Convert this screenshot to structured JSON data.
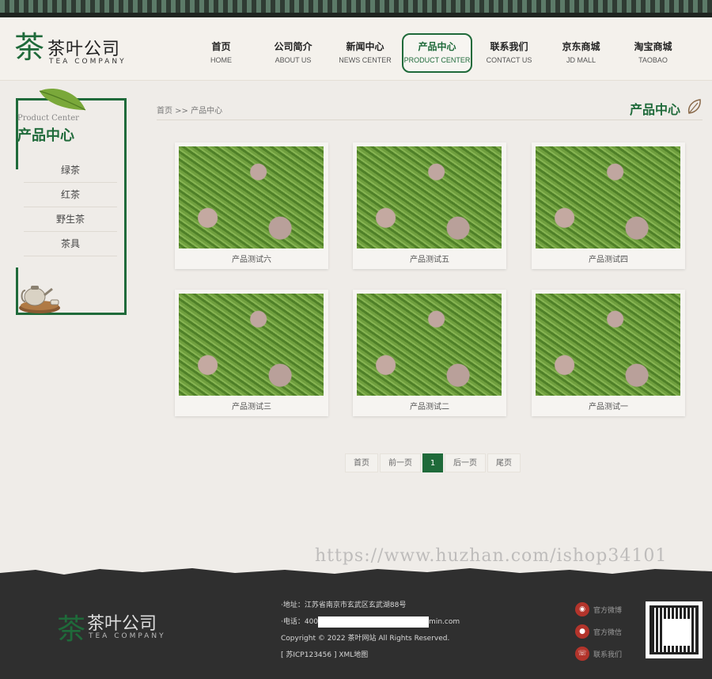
{
  "logo": {
    "mark": "茶",
    "name": "茶叶公司",
    "sub": "TEA COMPANY"
  },
  "nav": [
    {
      "cn": "首页",
      "en": "HOME"
    },
    {
      "cn": "公司简介",
      "en": "ABOUT US"
    },
    {
      "cn": "新闻中心",
      "en": "NEWS CENTER"
    },
    {
      "cn": "产品中心",
      "en": "PRODUCT CENTER"
    },
    {
      "cn": "联系我们",
      "en": "CONTACT US"
    },
    {
      "cn": "京东商城",
      "en": "JD MALL"
    },
    {
      "cn": "淘宝商城",
      "en": "TAOBAO"
    }
  ],
  "sidebar": {
    "en_title": "Product Center",
    "title": "产品中心",
    "items": [
      "绿茶",
      "红茶",
      "野生茶",
      "茶具"
    ]
  },
  "breadcrumb": {
    "home": "首页",
    "sep": " >> ",
    "current": "产品中心"
  },
  "section_title": "产品中心",
  "products": [
    "产品测试六",
    "产品测试五",
    "产品测试四",
    "产品测试三",
    "产品测试二",
    "产品测试一"
  ],
  "pager": {
    "first": "首页",
    "prev": "前一页",
    "current": "1",
    "next": "后一页",
    "last": "尾页"
  },
  "watermark": "https://www.huzhan.com/ishop34101",
  "footer": {
    "address": "·地址：江苏省南京市玄武区玄武湖88号",
    "phone_prefix": "·电话：400",
    "phone_suffix": "min.com",
    "copyright": "Copyright © 2022 茶叶网站 All Rights Reserved.",
    "icp": "[ 苏ICP123456 ] XML地图",
    "social": [
      {
        "icon": "weibo-icon",
        "label": "官方微博"
      },
      {
        "icon": "wechat-icon",
        "label": "官方微信"
      },
      {
        "icon": "phone-icon",
        "label": "联系我们"
      }
    ]
  },
  "colors": {
    "brand_green": "#1f6a3a",
    "footer_bg": "#2f2f2f",
    "page_bg": "#efece8"
  }
}
